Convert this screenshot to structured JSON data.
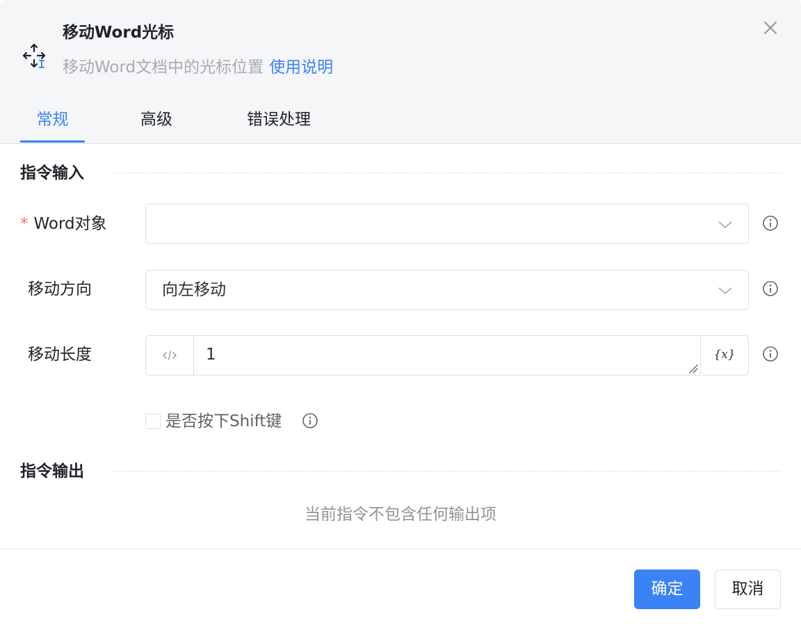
{
  "dialog": {
    "title": "移动Word光标",
    "subtitle": "移动Word文档中的光标位置",
    "help_link": "使用说明",
    "close_icon": "close-icon",
    "header_icon": "move-cursor-icon"
  },
  "tabs": [
    {
      "label": "常规",
      "active": true
    },
    {
      "label": "高级",
      "active": false
    },
    {
      "label": "错误处理",
      "active": false
    }
  ],
  "input_section": {
    "title": "指令输入",
    "fields": {
      "word_object": {
        "required_mark": "*",
        "label": "Word对象",
        "value": ""
      },
      "direction": {
        "label": "移动方向",
        "value": "向左移动"
      },
      "length": {
        "label": "移动长度",
        "value": "1",
        "var_button": "{x}"
      },
      "shift": {
        "label": "是否按下Shift键",
        "checked": false
      }
    }
  },
  "output_section": {
    "title": "指令输出",
    "empty_text": "当前指令不包含任何输出项"
  },
  "footer": {
    "confirm": "确定",
    "cancel": "取消"
  },
  "colors": {
    "accent": "#3b82f6",
    "required": "#f56c6c",
    "header_bg": "#f5f6f7"
  }
}
